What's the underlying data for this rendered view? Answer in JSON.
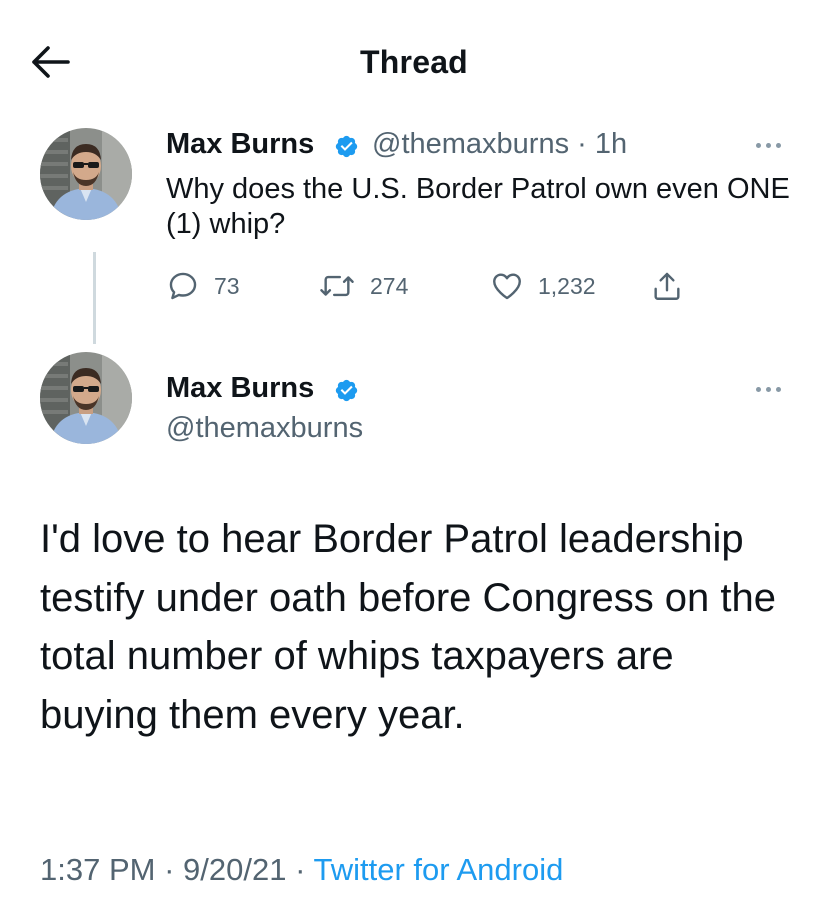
{
  "header": {
    "title": "Thread"
  },
  "parent_tweet": {
    "display_name": "Max Burns",
    "handle": "@themaxburns",
    "separator": "·",
    "time": "1h",
    "text": "Why does the U.S. Border Patrol own even ONE (1) whip?",
    "replies": "73",
    "retweets": "274",
    "likes": "1,232"
  },
  "main_tweet": {
    "display_name": "Max Burns",
    "handle": "@themaxburns",
    "text": "I'd love to hear Border Patrol leadership testify under oath before Congress on the total number of whips taxpayers are buying them every year.",
    "time": "1:37 PM",
    "date": "9/20/21",
    "source": "Twitter for Android",
    "separator": "·"
  },
  "colors": {
    "accent": "#1d9bf0",
    "secondary_text": "#536471",
    "primary_text": "#0f1419",
    "thread_line": "#cfd9de"
  },
  "icons": {
    "back": "arrow-left-icon",
    "verified": "verified-badge-icon",
    "more": "more-dots-icon",
    "reply": "reply-icon",
    "retweet": "retweet-icon",
    "like": "heart-icon",
    "share": "share-icon"
  }
}
